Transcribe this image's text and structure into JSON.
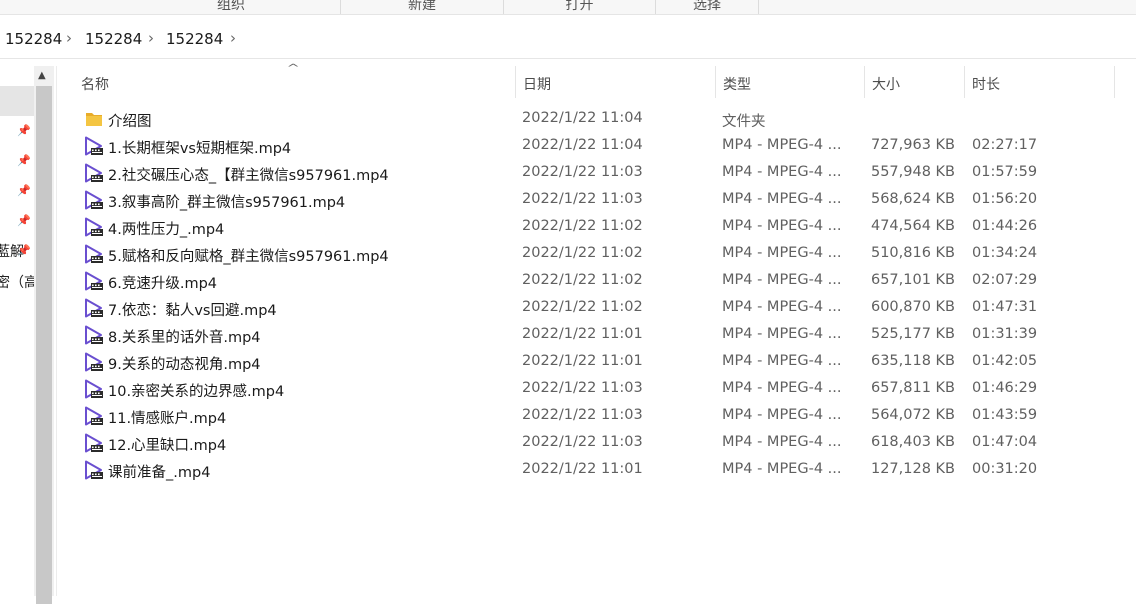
{
  "ribbon": {
    "groups": [
      "组织",
      "新建",
      "打开",
      "选择"
    ]
  },
  "breadcrumb": [
    "152284",
    "152284",
    "152284"
  ],
  "nav": {
    "cut_labels": [
      "藍解",
      "密（高"
    ]
  },
  "columns": {
    "name": "名称",
    "date": "日期",
    "type": "类型",
    "size": "大小",
    "duration": "时长"
  },
  "files": [
    {
      "icon": "folder-icon",
      "name": "介绍图",
      "date": "2022/1/22 11:04",
      "type": "文件夹",
      "size": "",
      "duration": ""
    },
    {
      "icon": "video-file-icon",
      "name": "1.长期框架vs短期框架.mp4",
      "date": "2022/1/22 11:04",
      "type": "MP4 - MPEG-4 ...",
      "size": "727,963 KB",
      "duration": "02:27:17"
    },
    {
      "icon": "video-file-icon",
      "name": "2.社交碾压心态_【群主微信s957961.mp4",
      "date": "2022/1/22 11:03",
      "type": "MP4 - MPEG-4 ...",
      "size": "557,948 KB",
      "duration": "01:57:59"
    },
    {
      "icon": "video-file-icon",
      "name": "3.叙事高阶_群主微信s957961.mp4",
      "date": "2022/1/22 11:03",
      "type": "MP4 - MPEG-4 ...",
      "size": "568,624 KB",
      "duration": "01:56:20"
    },
    {
      "icon": "video-file-icon",
      "name": "4.两性压力_.mp4",
      "date": "2022/1/22 11:02",
      "type": "MP4 - MPEG-4 ...",
      "size": "474,564 KB",
      "duration": "01:44:26"
    },
    {
      "icon": "video-file-icon",
      "name": "5.赋格和反向赋格_群主微信s957961.mp4",
      "date": "2022/1/22 11:02",
      "type": "MP4 - MPEG-4 ...",
      "size": "510,816 KB",
      "duration": "01:34:24"
    },
    {
      "icon": "video-file-icon",
      "name": "6.竞速升级.mp4",
      "date": "2022/1/22 11:02",
      "type": "MP4 - MPEG-4 ...",
      "size": "657,101 KB",
      "duration": "02:07:29"
    },
    {
      "icon": "video-file-icon",
      "name": "7.依恋：黏人vs回避.mp4",
      "date": "2022/1/22 11:02",
      "type": "MP4 - MPEG-4 ...",
      "size": "600,870 KB",
      "duration": "01:47:31"
    },
    {
      "icon": "video-file-icon",
      "name": "8.关系里的话外音.mp4",
      "date": "2022/1/22 11:01",
      "type": "MP4 - MPEG-4 ...",
      "size": "525,177 KB",
      "duration": "01:31:39"
    },
    {
      "icon": "video-file-icon",
      "name": "9.关系的动态视角.mp4",
      "date": "2022/1/22 11:01",
      "type": "MP4 - MPEG-4 ...",
      "size": "635,118 KB",
      "duration": "01:42:05"
    },
    {
      "icon": "video-file-icon",
      "name": "10.亲密关系的边界感.mp4",
      "date": "2022/1/22 11:03",
      "type": "MP4 - MPEG-4 ...",
      "size": "657,811 KB",
      "duration": "01:46:29"
    },
    {
      "icon": "video-file-icon",
      "name": "11.情感账户.mp4",
      "date": "2022/1/22 11:03",
      "type": "MP4 - MPEG-4 ...",
      "size": "564,072 KB",
      "duration": "01:43:59"
    },
    {
      "icon": "video-file-icon",
      "name": "12.心里缺口.mp4",
      "date": "2022/1/22 11:03",
      "type": "MP4 - MPEG-4 ...",
      "size": "618,403 KB",
      "duration": "01:47:04"
    },
    {
      "icon": "video-file-icon",
      "name": "课前准备_.mp4",
      "date": "2022/1/22 11:01",
      "type": "MP4 - MPEG-4 ...",
      "size": "127,128 KB",
      "duration": "00:31:20"
    }
  ],
  "colors": {
    "folder": "#f4c542",
    "video_icon": "#6a4fd0",
    "header_text": "#4d4d4d",
    "detail_text": "#606060"
  }
}
